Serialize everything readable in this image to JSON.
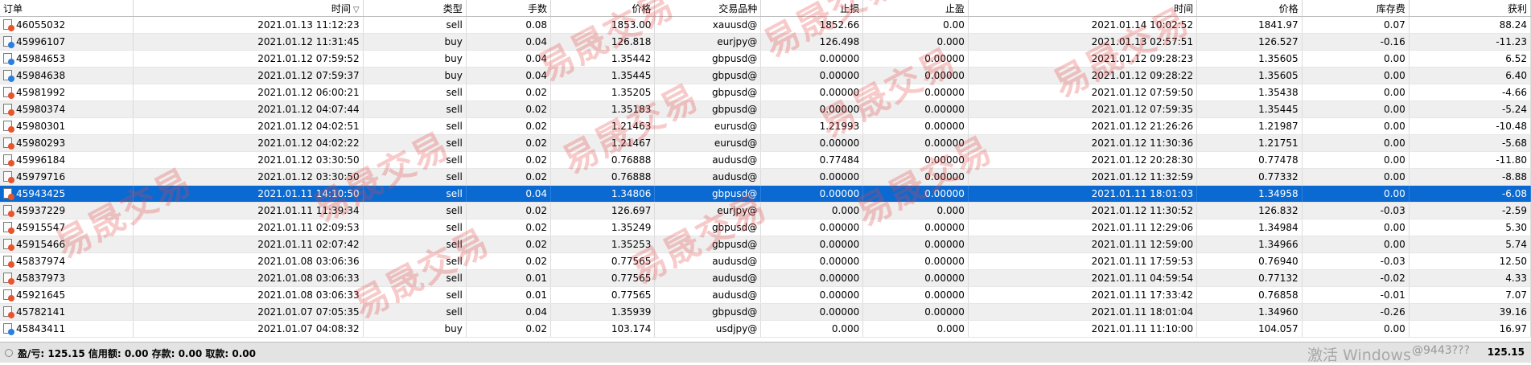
{
  "columns": [
    "订单",
    "时间",
    "类型",
    "手数",
    "价格",
    "交易品种",
    "止损",
    "止盈",
    "时间",
    "价格",
    "库存费",
    "获利"
  ],
  "sort_indicator": "▽",
  "rows": [
    [
      "46055032",
      "2021.01.13 11:12:23",
      "sell",
      "0.08",
      "1853.00",
      "xauusd@",
      "1852.66",
      "0.00",
      "2021.01.14 10:02:52",
      "1841.97",
      "0.07",
      "88.24"
    ],
    [
      "45996107",
      "2021.01.12 11:31:45",
      "buy",
      "0.04",
      "126.818",
      "eurjpy@",
      "126.498",
      "0.000",
      "2021.01.13 02:57:51",
      "126.527",
      "-0.16",
      "-11.23"
    ],
    [
      "45984653",
      "2021.01.12 07:59:52",
      "buy",
      "0.04",
      "1.35442",
      "gbpusd@",
      "0.00000",
      "0.00000",
      "2021.01.12 09:28:23",
      "1.35605",
      "0.00",
      "6.52"
    ],
    [
      "45984638",
      "2021.01.12 07:59:37",
      "buy",
      "0.04",
      "1.35445",
      "gbpusd@",
      "0.00000",
      "0.00000",
      "2021.01.12 09:28:22",
      "1.35605",
      "0.00",
      "6.40"
    ],
    [
      "45981992",
      "2021.01.12 06:00:21",
      "sell",
      "0.02",
      "1.35205",
      "gbpusd@",
      "0.00000",
      "0.00000",
      "2021.01.12 07:59:50",
      "1.35438",
      "0.00",
      "-4.66"
    ],
    [
      "45980374",
      "2021.01.12 04:07:44",
      "sell",
      "0.02",
      "1.35183",
      "gbpusd@",
      "0.00000",
      "0.00000",
      "2021.01.12 07:59:35",
      "1.35445",
      "0.00",
      "-5.24"
    ],
    [
      "45980301",
      "2021.01.12 04:02:51",
      "sell",
      "0.02",
      "1.21463",
      "eurusd@",
      "1.21993",
      "0.00000",
      "2021.01.12 21:26:26",
      "1.21987",
      "0.00",
      "-10.48"
    ],
    [
      "45980293",
      "2021.01.12 04:02:22",
      "sell",
      "0.02",
      "1.21467",
      "eurusd@",
      "0.00000",
      "0.00000",
      "2021.01.12 11:30:36",
      "1.21751",
      "0.00",
      "-5.68"
    ],
    [
      "45996184",
      "2021.01.12 03:30:50",
      "sell",
      "0.02",
      "0.76888",
      "audusd@",
      "0.77484",
      "0.00000",
      "2021.01.12 20:28:30",
      "0.77478",
      "0.00",
      "-11.80"
    ],
    [
      "45979716",
      "2021.01.12 03:30:50",
      "sell",
      "0.02",
      "0.76888",
      "audusd@",
      "0.00000",
      "0.00000",
      "2021.01.12 11:32:59",
      "0.77332",
      "0.00",
      "-8.88"
    ],
    [
      "45943425",
      "2021.01.11 14:10:50",
      "sell",
      "0.04",
      "1.34806",
      "gbpusd@",
      "0.00000",
      "0.00000",
      "2021.01.11 18:01:03",
      "1.34958",
      "0.00",
      "-6.08"
    ],
    [
      "45937229",
      "2021.01.11 11:39:34",
      "sell",
      "0.02",
      "126.697",
      "eurjpy@",
      "0.000",
      "0.000",
      "2021.01.12 11:30:52",
      "126.832",
      "-0.03",
      "-2.59"
    ],
    [
      "45915547",
      "2021.01.11 02:09:53",
      "sell",
      "0.02",
      "1.35249",
      "gbpusd@",
      "0.00000",
      "0.00000",
      "2021.01.11 12:29:06",
      "1.34984",
      "0.00",
      "5.30"
    ],
    [
      "45915466",
      "2021.01.11 02:07:42",
      "sell",
      "0.02",
      "1.35253",
      "gbpusd@",
      "0.00000",
      "0.00000",
      "2021.01.11 12:59:00",
      "1.34966",
      "0.00",
      "5.74"
    ],
    [
      "45837974",
      "2021.01.08 03:06:36",
      "sell",
      "0.02",
      "0.77565",
      "audusd@",
      "0.00000",
      "0.00000",
      "2021.01.11 17:59:53",
      "0.76940",
      "-0.03",
      "12.50"
    ],
    [
      "45837973",
      "2021.01.08 03:06:33",
      "sell",
      "0.01",
      "0.77565",
      "audusd@",
      "0.00000",
      "0.00000",
      "2021.01.11 04:59:54",
      "0.77132",
      "-0.02",
      "4.33"
    ],
    [
      "45921645",
      "2021.01.08 03:06:33",
      "sell",
      "0.01",
      "0.77565",
      "audusd@",
      "0.00000",
      "0.00000",
      "2021.01.11 17:33:42",
      "0.76858",
      "-0.01",
      "7.07"
    ],
    [
      "45782141",
      "2021.01.07 07:05:35",
      "sell",
      "0.04",
      "1.35939",
      "gbpusd@",
      "0.00000",
      "0.00000",
      "2021.01.11 18:01:04",
      "1.34960",
      "-0.26",
      "39.16"
    ],
    [
      "45843411",
      "2021.01.07 04:08:32",
      "buy",
      "0.02",
      "103.174",
      "usdjpy@",
      "0.000",
      "0.000",
      "2021.01.11 11:10:00",
      "104.057",
      "0.00",
      "16.97"
    ]
  ],
  "selected_order": "45943425",
  "status": {
    "text": "盈/亏: 125.15  信用额: 0.00  存款: 0.00  取款: 0.00",
    "total": "125.15"
  },
  "watermark_text": "易晟交易",
  "overlay": {
    "activate_windows": "激活 Windows",
    "user_tag": "@9443???"
  },
  "colors": {
    "selected_row": "#0a6ad1",
    "alt_row": "#efefef",
    "sell_badge": "#e8542c",
    "buy_badge": "#2a7fe0",
    "watermark": "#e64646"
  }
}
